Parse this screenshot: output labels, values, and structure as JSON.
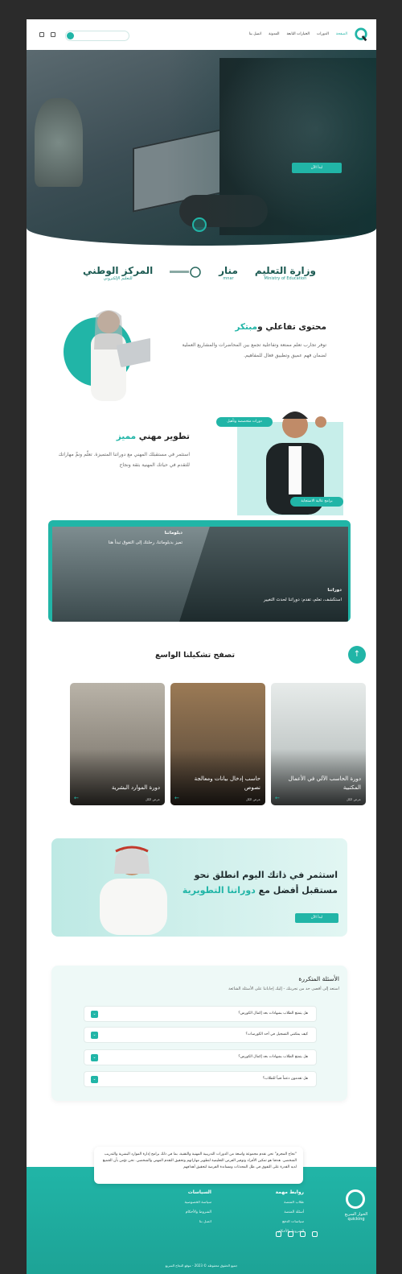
{
  "header": {
    "nav": [
      "الصفحة",
      "الدورات",
      "الخيارات التابعة",
      "المدونة",
      "اتصل بنا"
    ],
    "active_index": 0
  },
  "hero": {
    "cta_label": "ابدأ الآن"
  },
  "partners": [
    {
      "name": "وزارة التعليم",
      "sub": "Ministry of Education"
    },
    {
      "name": "منار",
      "sub": "mnar"
    },
    {
      "name": "",
      "sub": ""
    },
    {
      "name": "المركز الوطني",
      "sub": "للتعليم الإلكتروني"
    }
  ],
  "feature1": {
    "title_plain": "محتوى تفاعلي و",
    "title_accent": "مبتكر",
    "body": "توفر تجارب تعلم ممتعة وتفاعلية تجمع بين المحاضرات والمشاريع العملية لضمان فهم عميق وتطبيق فعال للمفاهيم."
  },
  "feature2": {
    "title_plain": "تطوير مهني ",
    "title_accent": "مميز",
    "body": "استثمر في مستقبلك المهني مع دوراتنا المتميزة. تعلّم ونمِّ مهاراتك للتقدم في حياتك المهنية بثقة ونجاح",
    "pill_top": "دورات متخصصة وتأهيل",
    "pill_bottom": "برامج عالية الاستجابة"
  },
  "programs": {
    "left_kicker": "دبلوماتنا",
    "left_title": "تميز بدبلوماتنا، رحلتك إلى التفوق تبدأ هنا",
    "right_kicker": "دوراتنا",
    "right_title": "استكشف، تعلم، تقدم: دوراتنا لحدث التغيير"
  },
  "catalog": {
    "heading": "تصفح تشكيلنا الواسع",
    "cards": [
      {
        "title": "دورة الحاسب الآلي في الأعمال المكتبية",
        "meta": "عرض الكل"
      },
      {
        "title": "حاسب إدخال بيانات ومعالجة نصوص",
        "meta": "عرض الكل"
      },
      {
        "title": "دورة الموارد البشرية",
        "meta": "عرض الكل"
      }
    ]
  },
  "invest": {
    "line1": "استثمر في ذاتك اليوم انطلق نحو",
    "line2_plain": "مستقبل أفضل مع ",
    "line2_accent": "دوراتنا التطويرية",
    "cta_label": "ابدأ الآن"
  },
  "faq": {
    "title": "الأسئلة المتكررة",
    "subtitle": "استعد إلى أقصى حد من تجربتك - إليك إجاباتنا على الأسئلة الشائعة",
    "items": [
      "هل يتمتع الطلاب بشهادات بعد إكمال الكورس؟",
      "كيف يمكنني التسجيل في أحد الكورسات؟",
      "هل يتمتع الطلاب بشهادات بعد إكمال الكورس؟",
      "هل تقدمون دعماً فنياً للطلاب؟"
    ]
  },
  "footer": {
    "about": "\"نجاح المجرم\" نحن نقدم مجموعة واسعة من الدورات التدريبية المهنية والتقنية، بما في ذلك برامج إدارة الموارد البشرية والتدريب الشخصي. هدفنا هو تمكين الأفراد وتوفير الفرص التعليمية لتطوير مهاراتهم وتحقيق التقدم المهني والشخصي. نحن نؤمن بأن الجميع لديه القدرة على التفوق في ظل المحدثات ومساندة الفرصة لتحقيق أهدافهم",
    "col1_title": "روابط مهمة",
    "col1_links": [
      "طلاب المنصة",
      "أسئلة المنصة",
      "سياسات الدفع",
      "الشروط والأحكام"
    ],
    "col2_title": "السياسات",
    "col2_links": [
      "سياسة الخصوصية",
      "الشروط والأحكام",
      "اتصل بنا"
    ],
    "brand": "الحوار السريع quicking",
    "copyright": "جميع الحقوق محفوظة © 2023 - موقع النجاح السريع"
  },
  "colors": {
    "accent": "#21b5a7",
    "dark": "#1e2a2c"
  }
}
